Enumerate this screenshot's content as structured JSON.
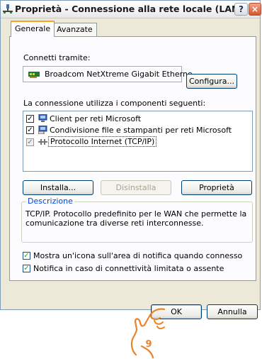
{
  "window": {
    "title": "Proprietà - Connessione alla rete locale (LAN)",
    "help_label": "?",
    "close_label": "×"
  },
  "tabs": [
    {
      "label": "Generale"
    },
    {
      "label": "Avanzate"
    }
  ],
  "connect_using": {
    "label": "Connetti tramite:",
    "adapter": "Broadcom NetXtreme Gigabit Etherne",
    "configure_label": "Configura..."
  },
  "components": {
    "label": "La connessione utilizza i componenti seguenti:",
    "items": [
      {
        "label": "Client per reti Microsoft",
        "checked": true,
        "icon": "network-client-icon"
      },
      {
        "label": "Condivisione file e stampanti per reti Microsoft",
        "checked": true,
        "icon": "file-printer-sharing-icon"
      },
      {
        "label": "Protocollo Internet (TCP/IP)",
        "checked": true,
        "icon": "protocol-icon"
      }
    ]
  },
  "buttons": {
    "install": "Installa...",
    "uninstall": "Disinstalla",
    "properties": "Proprietà",
    "ok": "OK",
    "cancel": "Annulla"
  },
  "description": {
    "title": "Descrizione",
    "text": "TCP/IP. Protocollo predefinito per le WAN che permette la comunicazione tra diverse reti interconnesse."
  },
  "options": [
    {
      "label": "Mostra un'icona sull'area di notifica quando connesso",
      "checked": true
    },
    {
      "label": "Notifica in caso di connettività limitata o assente",
      "checked": true
    }
  ],
  "step_badge": "9",
  "colors": {
    "accent_orange": "#e8842a",
    "title_link_blue": "#0046d5",
    "window_face": "#ece9d8"
  }
}
